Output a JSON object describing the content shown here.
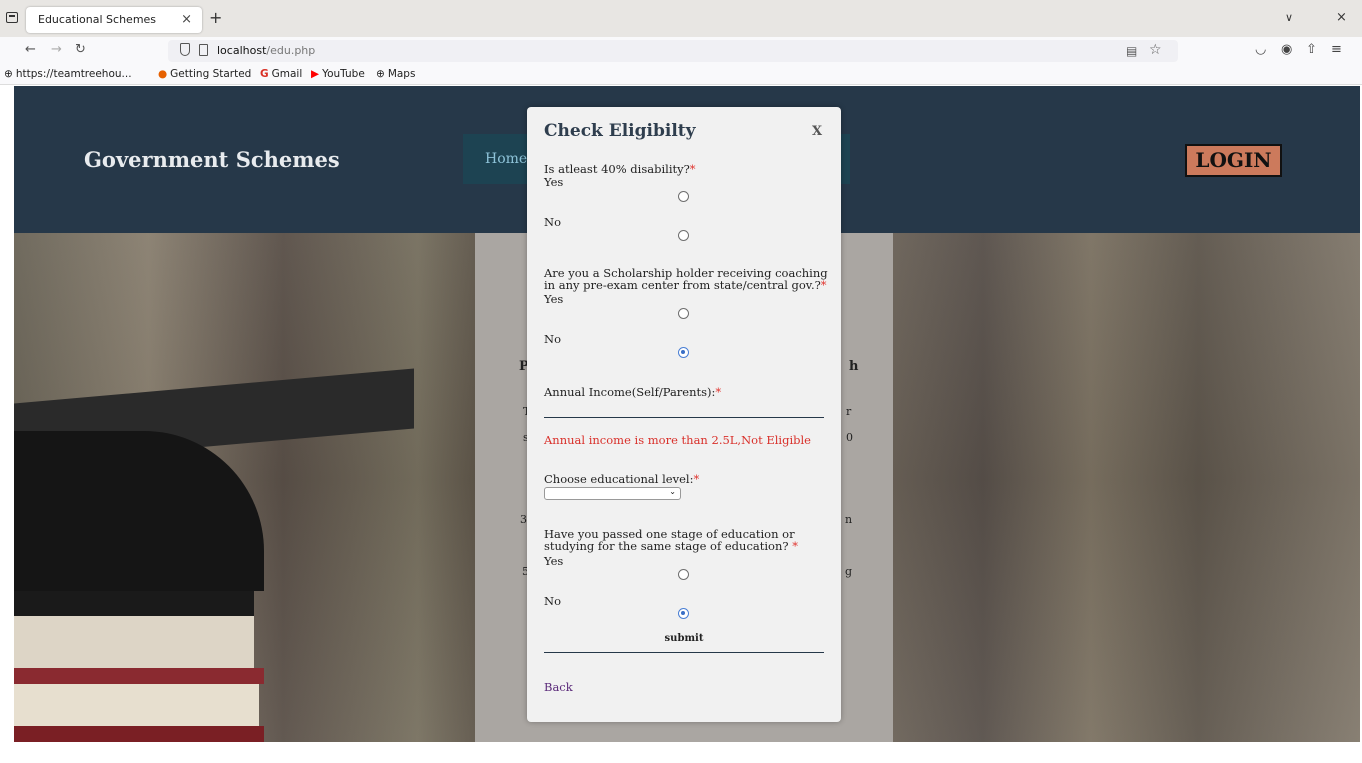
{
  "browser": {
    "tab_title": "Educational Schemes",
    "tab_close": "×",
    "new_tab": "+",
    "tabs_menu": "∨",
    "window_close": "×",
    "url_host": "localhost",
    "url_path": "/edu.php",
    "bookmarks": [
      {
        "icon": "globe-icon",
        "label": "https://teamtreehou..."
      },
      {
        "icon": "firefox-icon",
        "label": "Getting Started"
      },
      {
        "icon": "gmail-icon",
        "label": "Gmail"
      },
      {
        "icon": "youtube-icon",
        "label": "YouTube"
      },
      {
        "icon": "globe-icon",
        "label": "Maps"
      }
    ]
  },
  "header": {
    "site_title": "Government Schemes",
    "nav_home": "Home",
    "login": "LOGIN"
  },
  "background_card": {
    "heading_start": "P",
    "heading_end": "h",
    "line1_start": "T",
    "line1_end": "r",
    "line2_start": "s",
    "line2_end": "0",
    "line3_start": "3",
    "line3_end": "n",
    "line4_start": "5",
    "line4_end": "g"
  },
  "modal": {
    "title": "Check Eligibilty",
    "close": "X",
    "q1_label": "Is atleast 40% disability?",
    "q2_label_line1": "Are you a Scholarship holder receiving coaching",
    "q2_label_line2": "in any pre-exam center from state/central gov.?",
    "income_label": "Annual Income(Self/Parents):",
    "income_error": "Annual income is more than 2.5L,Not Eligible",
    "edu_level_label": "Choose educational level:",
    "edu_level_value": "",
    "q3_label_line1": "Have you passed one stage of education or",
    "q3_label_line2": "studying for the same stage of education? ",
    "required_mark": "*",
    "yes": "Yes",
    "no": "No",
    "answers": {
      "q1": "none",
      "q2": "No",
      "q3": "No"
    },
    "submit": "submit",
    "back": "Back"
  }
}
